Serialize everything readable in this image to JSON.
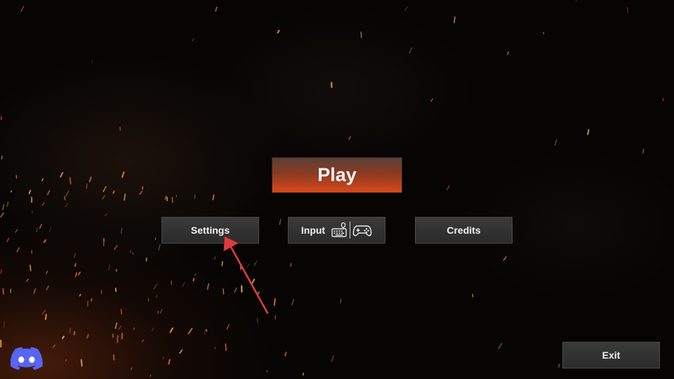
{
  "menu": {
    "play_label": "Play",
    "settings_label": "Settings",
    "input_label": "Input",
    "credits_label": "Credits",
    "exit_label": "Exit"
  },
  "icons": {
    "input_icons": [
      "keyboard-mouse-icon",
      "gamepad-icon"
    ],
    "social": "discord-icon",
    "annotation": "red-arrow"
  },
  "colors": {
    "play_top": "#5a4038",
    "play_bottom": "#d9481a",
    "button_gray": "#2f2f2f",
    "text": "#f2f2f2",
    "discord": "#5865F2",
    "annotation_arrow": "#e03a3e"
  }
}
